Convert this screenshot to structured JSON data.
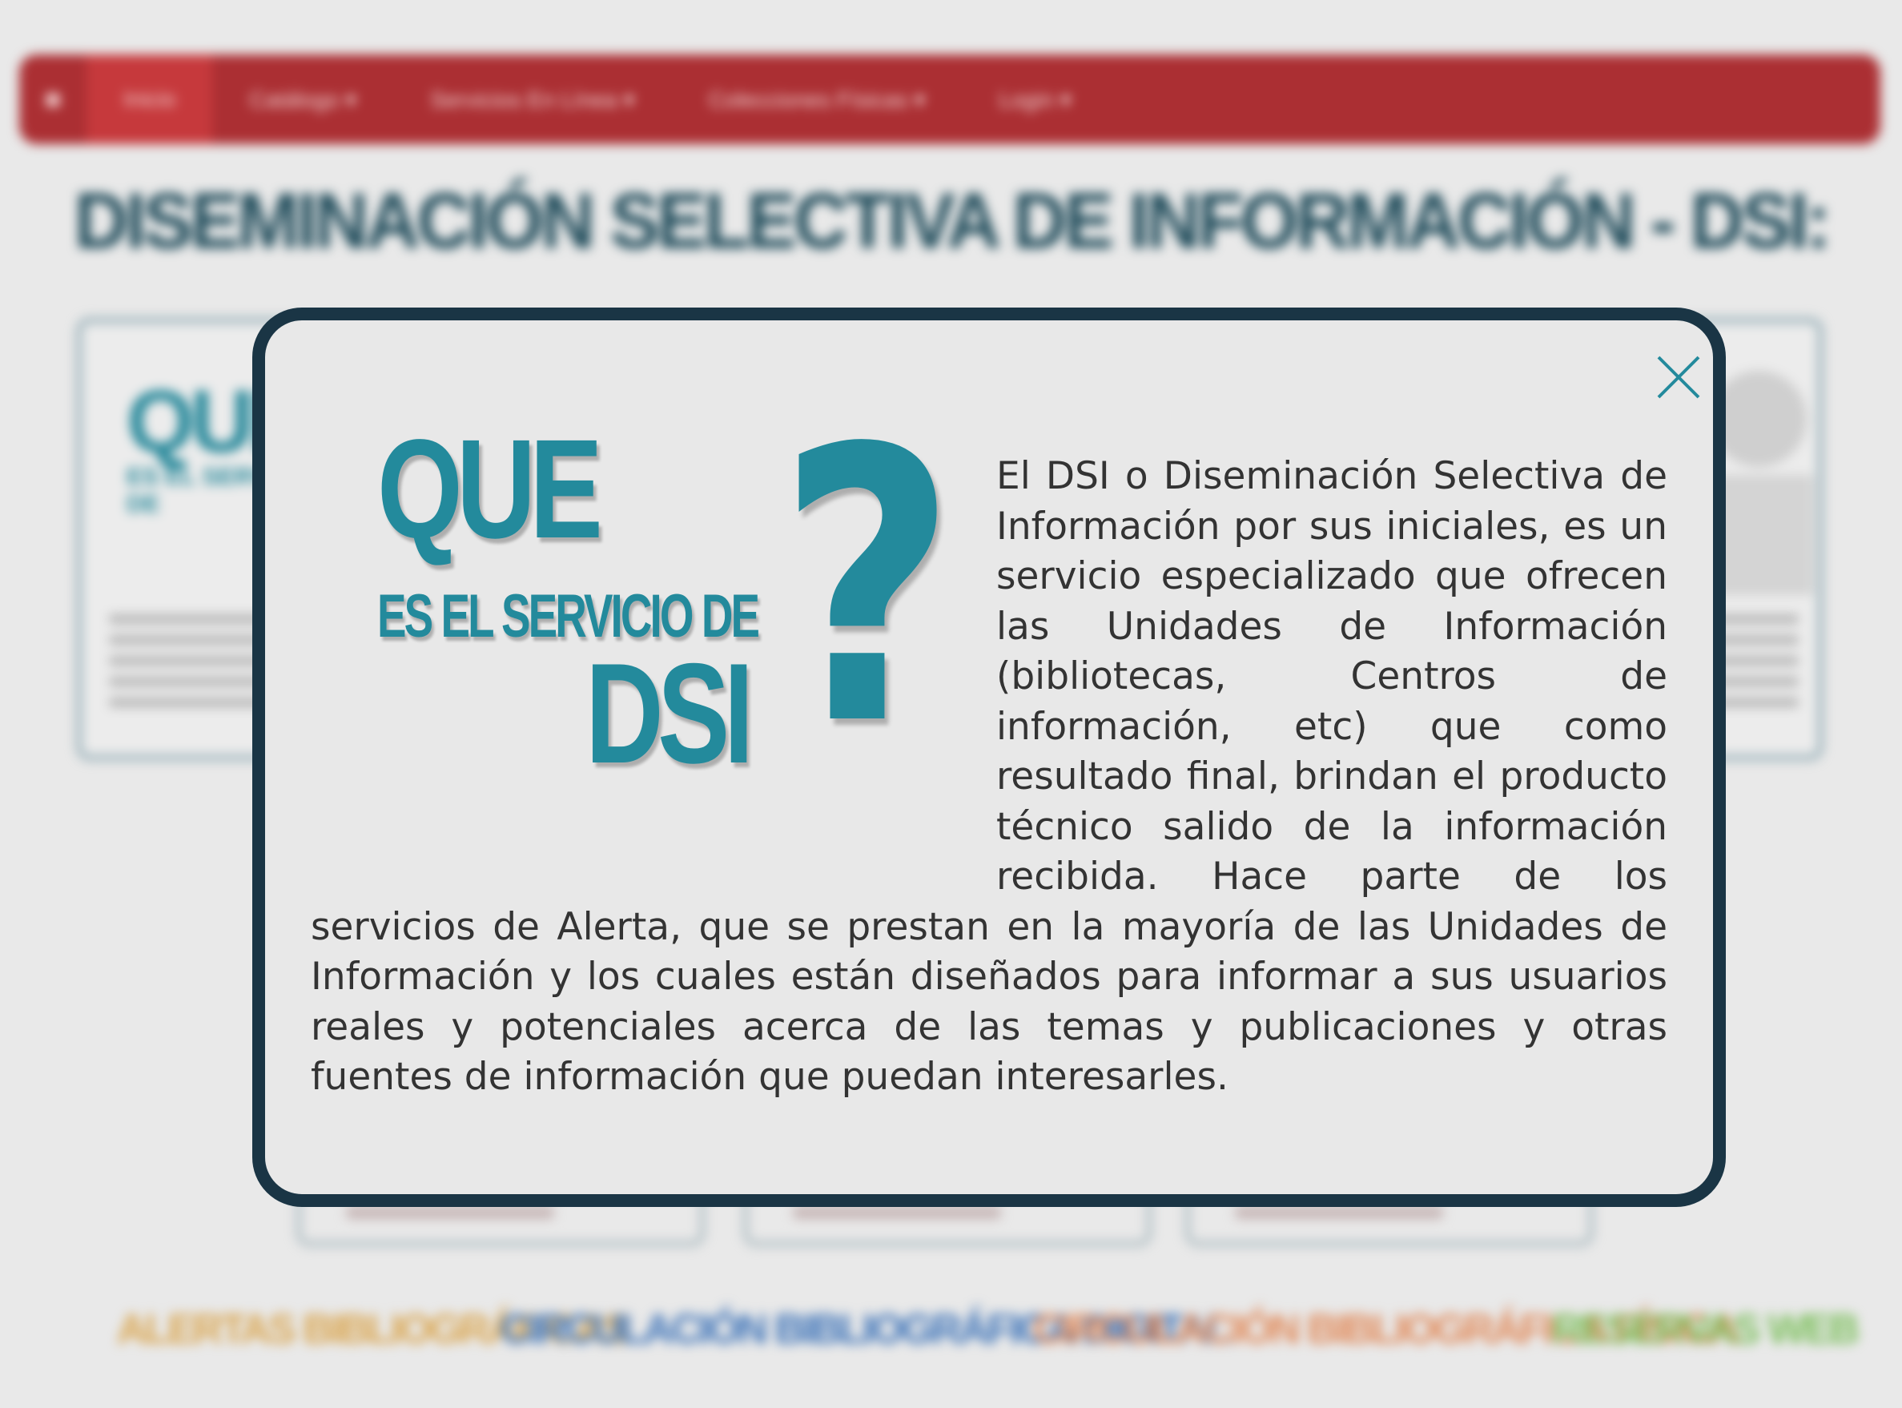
{
  "background": {
    "nav": {
      "items": [
        {
          "label": "Inicio"
        },
        {
          "label": "Catálogo ▾"
        },
        {
          "label": "Servicios En Línea ▾"
        },
        {
          "label": "Colecciones Físicas ▾"
        },
        {
          "label": "Login ▾"
        }
      ]
    },
    "page_title": "DISEMINACIÓN SELECTIVA DE INFORMACIÓN - DSI:",
    "card": {
      "title": "QUE",
      "subtitle": "ES EL SERVICIO DE"
    },
    "categories": [
      {
        "label": "ALERTAS BIBLIOGRÁFICAS",
        "color": "#d9a54f"
      },
      {
        "label": "CIRCULACIÓN BIBLIOGRÁFICA DIGITAL",
        "color": "#3d73b8"
      },
      {
        "label": "CIRCULACIÓN BIBLIOGRÁFICA FÍSICA",
        "color": "#e08a5a"
      },
      {
        "label": "RESERVAS WEB",
        "color": "#7cbf5c"
      }
    ],
    "colors": {
      "nav": "#ab2f33",
      "title": "#1f4b5a"
    }
  },
  "modal": {
    "close_icon": "close-icon",
    "headline": {
      "line1": "QUE",
      "line2": "ES EL SERVICIO DE",
      "line3": "DSI",
      "mark": "?"
    },
    "body": "El DSI o Diseminación Selectiva de Información por sus iniciales, es un servicio especializado que ofrecen las Unidades de Información (bibliotecas, Centros de información, etc) que como resultado final, brindan el producto técnico salido de la información recibida. Hace parte de los servicios de Alerta, que se prestan en la mayoría de las Unidades de Información y los cuales están diseñados para informar a sus usuarios reales y potenciales acerca de las temas y publicaciones y otras fuentes de información que puedan interesarles.",
    "colors": {
      "border": "#1a3545",
      "accent": "#238a9c",
      "text": "#333333"
    }
  }
}
